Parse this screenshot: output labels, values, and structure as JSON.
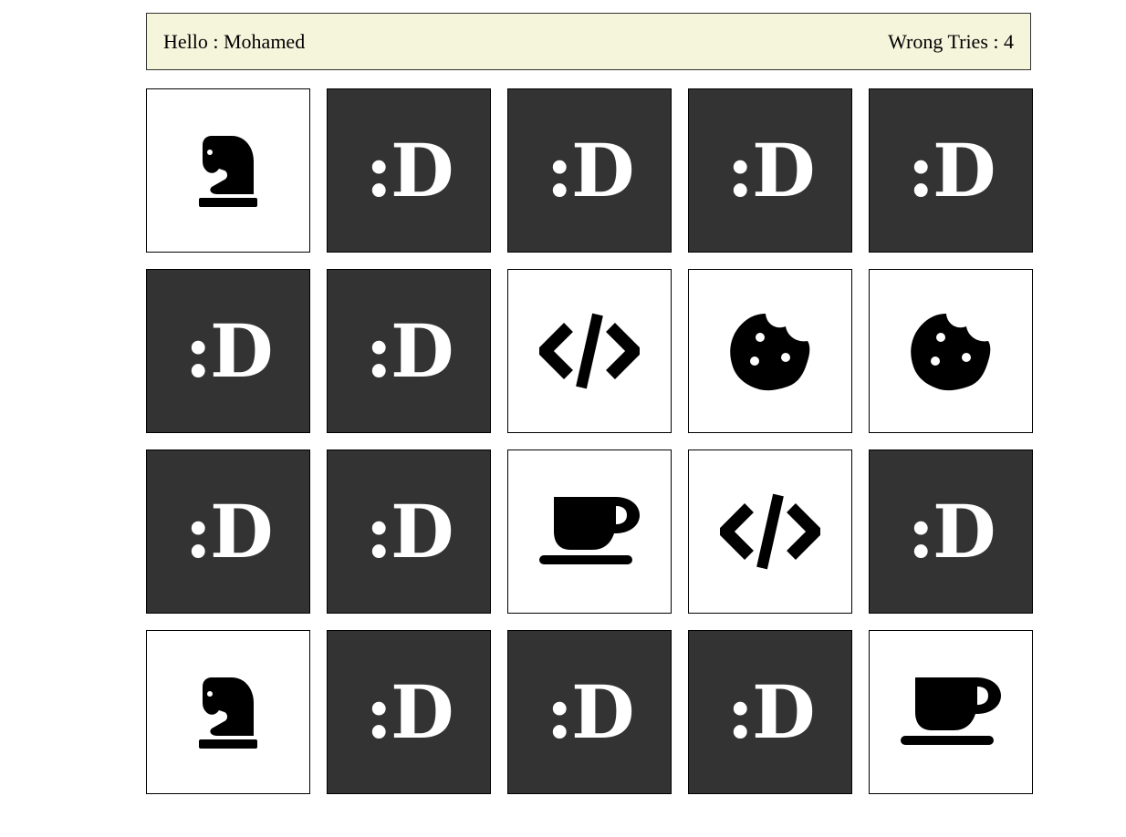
{
  "header": {
    "greeting": "Hello : Mohamed",
    "wrong_tries": "Wrong Tries : 4"
  },
  "card_back_text": ":D",
  "colors": {
    "info_bar_bg": "#f5f5dc",
    "card_back_bg": "#333333",
    "card_front_bg": "#ffffff"
  },
  "cards": [
    {
      "state": "flipped",
      "icon": "chess-knight-icon"
    },
    {
      "state": "hidden",
      "icon": ""
    },
    {
      "state": "hidden",
      "icon": ""
    },
    {
      "state": "hidden",
      "icon": ""
    },
    {
      "state": "hidden",
      "icon": ""
    },
    {
      "state": "hidden",
      "icon": ""
    },
    {
      "state": "hidden",
      "icon": ""
    },
    {
      "state": "flipped",
      "icon": "code-icon"
    },
    {
      "state": "flipped",
      "icon": "cookie-icon"
    },
    {
      "state": "flipped",
      "icon": "cookie-icon"
    },
    {
      "state": "hidden",
      "icon": ""
    },
    {
      "state": "hidden",
      "icon": ""
    },
    {
      "state": "flipped",
      "icon": "coffee-icon"
    },
    {
      "state": "flipped",
      "icon": "code-icon"
    },
    {
      "state": "hidden",
      "icon": ""
    },
    {
      "state": "flipped",
      "icon": "chess-knight-icon"
    },
    {
      "state": "hidden",
      "icon": ""
    },
    {
      "state": "hidden",
      "icon": ""
    },
    {
      "state": "hidden",
      "icon": ""
    },
    {
      "state": "flipped",
      "icon": "coffee-icon"
    }
  ]
}
